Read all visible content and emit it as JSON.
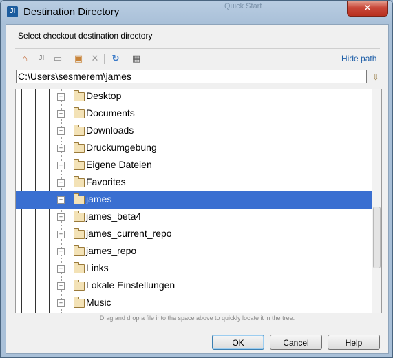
{
  "window": {
    "title": "Destination Directory",
    "app_icon": "JI",
    "ghost_title": "Quick Start",
    "close_glyph": "✕"
  },
  "header": {
    "subtitle": "Select checkout destination directory",
    "hide_path_label": "Hide path"
  },
  "toolbar": {
    "icons": [
      "home-icon",
      "project-icon",
      "module-icon",
      "new-folder-icon",
      "delete-icon",
      "refresh-icon",
      "show-hidden-icon"
    ]
  },
  "path": {
    "value": "C:\\Users\\sesmerem\\james"
  },
  "tree": {
    "items": [
      {
        "label": "Desktop"
      },
      {
        "label": "Documents"
      },
      {
        "label": "Downloads"
      },
      {
        "label": "Druckumgebung"
      },
      {
        "label": "Eigene Dateien"
      },
      {
        "label": "Favorites"
      },
      {
        "label": "james",
        "selected": true
      },
      {
        "label": "james_beta4"
      },
      {
        "label": "james_current_repo"
      },
      {
        "label": "james_repo"
      },
      {
        "label": "Links"
      },
      {
        "label": "Lokale Einstellungen"
      },
      {
        "label": "Music"
      }
    ],
    "selection_color": "#3a6fd1"
  },
  "hint": "Drag and drop a file into the space above to quickly locate it in the tree.",
  "buttons": {
    "ok": "OK",
    "cancel": "Cancel",
    "help": "Help"
  }
}
